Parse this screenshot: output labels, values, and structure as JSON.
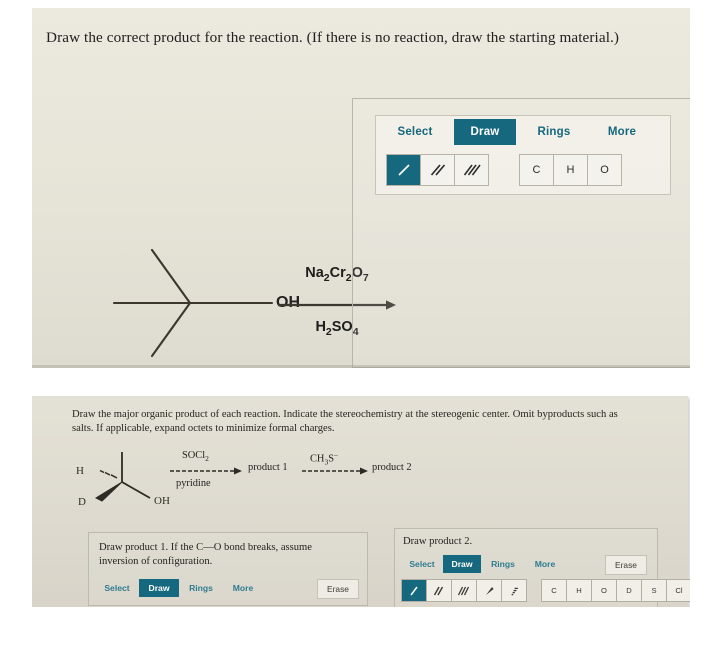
{
  "panel_top": {
    "question": "Draw the correct product for the reaction. (If there is no reaction, draw the starting material.)",
    "reaction": {
      "reagent_above": "Na2Cr2O7",
      "reagent_above_parts": [
        "Na",
        "2",
        "Cr",
        "2",
        "O",
        "7"
      ],
      "reagent_below": "H2SO4",
      "reagent_below_parts": [
        "H",
        "2",
        "SO",
        "4"
      ],
      "substituent_label": "OH",
      "arrow": "reaction-arrow"
    },
    "widget": {
      "tabs": [
        {
          "label": "Select",
          "active": false
        },
        {
          "label": "Draw",
          "active": true
        },
        {
          "label": "Rings",
          "active": false
        },
        {
          "label": "More",
          "active": false
        }
      ],
      "bond_tools": [
        {
          "name": "single-bond",
          "glyph": "/",
          "active": true
        },
        {
          "name": "double-bond",
          "glyph": "//",
          "active": false
        },
        {
          "name": "triple-bond",
          "glyph": "///",
          "active": false
        }
      ],
      "element_tools": [
        {
          "label": "C",
          "active": false
        },
        {
          "label": "H",
          "active": false
        },
        {
          "label": "O",
          "active": false
        }
      ]
    }
  },
  "panel_bottom": {
    "instruction_line1": "Draw the major organic product of each reaction. Indicate the stereochemistry at the stereogenic center. Omit byproducts such as",
    "instruction_line2": "salts. If applicable, expand octets to minimize formal charges.",
    "scheme": {
      "atom_h": "H",
      "atom_d": "D",
      "atom_oh": "OH",
      "step1_reagent": "SOCl2",
      "step1_reagent_parts": [
        "SOCl",
        "2"
      ],
      "step1_solvent": "pyridine",
      "step1_product": "product 1",
      "step2_reagent": "CH3S-",
      "step2_reagent_parts": [
        "CH",
        "3",
        "S",
        "–"
      ],
      "step2_product": "product 2"
    },
    "sub_left": {
      "label_line1": "Draw product 1. If the C—O bond breaks, assume",
      "label_line2": "inversion of configuration.",
      "tabs": [
        {
          "label": "Select",
          "active": false
        },
        {
          "label": "Draw",
          "active": true
        },
        {
          "label": "Rings",
          "active": false
        },
        {
          "label": "More",
          "active": false
        }
      ],
      "erase_label": "Erase"
    },
    "sub_right": {
      "label": "Draw product 2.",
      "tabs": [
        {
          "label": "Select",
          "active": false
        },
        {
          "label": "Draw",
          "active": true
        },
        {
          "label": "Rings",
          "active": false
        },
        {
          "label": "More",
          "active": false
        }
      ],
      "erase_label": "Erase",
      "bond_tools": [
        {
          "name": "single-bond",
          "glyph": "/",
          "active": true
        },
        {
          "name": "double-bond",
          "glyph": "//",
          "active": false
        },
        {
          "name": "triple-bond",
          "glyph": "///",
          "active": false
        },
        {
          "name": "wedge-bond",
          "glyph": "◤",
          "active": false
        },
        {
          "name": "hash-bond",
          "glyph": "◥",
          "active": false
        }
      ],
      "element_tools": [
        {
          "label": "C",
          "active": false
        },
        {
          "label": "H",
          "active": false
        },
        {
          "label": "O",
          "active": false
        },
        {
          "label": "D",
          "active": false
        },
        {
          "label": "S",
          "active": false
        },
        {
          "label": "Cl",
          "active": false
        }
      ]
    }
  },
  "colors": {
    "accent_teal": "#16687e",
    "panel_top_bg": "#e8e5da",
    "panel_bottom_bg": "#ddd9ce",
    "text": "#20201e"
  }
}
